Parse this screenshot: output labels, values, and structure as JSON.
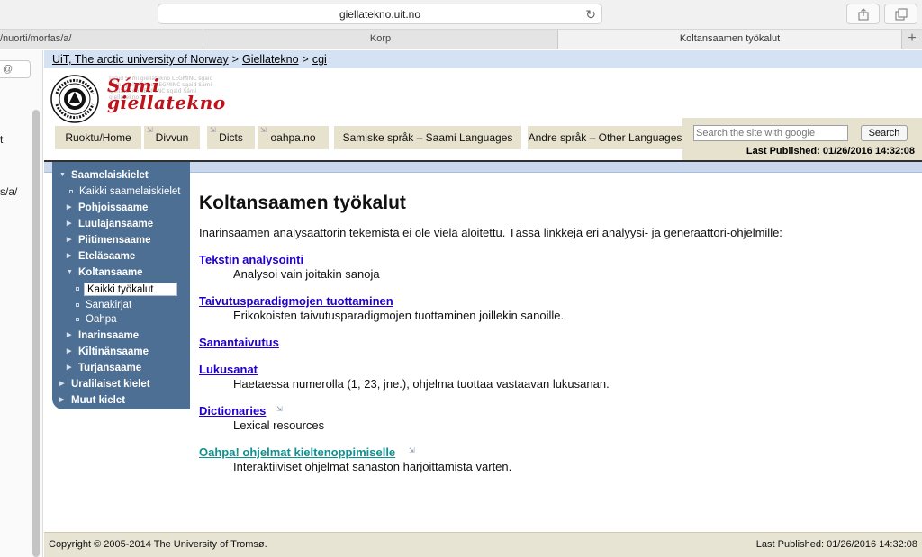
{
  "browser": {
    "address": "giellatekno.uit.no",
    "tabs": [
      "/nuorti/morfas/a/",
      "Korp",
      "Koltansaamen työkalut"
    ]
  },
  "sidepanel": {
    "lines": [
      "t",
      "s/a/"
    ]
  },
  "breadcrumb": {
    "items": [
      "UiT, The arctic university of Norway",
      "Giellatekno",
      "cgi"
    ],
    "separator": ">"
  },
  "logo": {
    "line1": "Sámi",
    "line2": "giellatekno",
    "seal_text": "ROMSSA UNIVERSITEHTA"
  },
  "nav": {
    "tabs": [
      "Ruoktu/Home",
      "Divvun",
      "Dicts",
      "oahpa.no",
      "Samiske språk – Saami Languages",
      "Andre språk – Other Languages"
    ]
  },
  "search": {
    "placeholder": "Search the site with google",
    "button": "Search"
  },
  "published": "Last Published: 01/26/2016 14:32:08",
  "menu": {
    "items": [
      {
        "label": "Saamelaiskielet",
        "level": 0,
        "open": true
      },
      {
        "label": "Kaikki saamelaiskielet",
        "level": 1
      },
      {
        "label": "Pohjoissaame",
        "level": 1,
        "group": true
      },
      {
        "label": "Luulajansaame",
        "level": 1,
        "group": true
      },
      {
        "label": "Piitimensaame",
        "level": 1,
        "group": true
      },
      {
        "label": "Eteläsaame",
        "level": 1,
        "group": true
      },
      {
        "label": "Koltansaame",
        "level": 1,
        "group": true,
        "open": true
      },
      {
        "label": "Kaikki työkalut",
        "level": 2,
        "selected": true
      },
      {
        "label": "Sanakirjat",
        "level": 2
      },
      {
        "label": "Oahpa",
        "level": 2
      },
      {
        "label": "Inarinsaame",
        "level": 1,
        "group": true
      },
      {
        "label": "Kiltinänsaame",
        "level": 1,
        "group": true
      },
      {
        "label": "Turjansaame",
        "level": 1,
        "group": true
      },
      {
        "label": "Uralilaiset kielet",
        "level": 0
      },
      {
        "label": "Muut kielet",
        "level": 0
      }
    ]
  },
  "content": {
    "title": "Koltansaamen työkalut",
    "intro": "Inarinsaamen analysaattorin tekemistä ei ole vielä aloitettu. Tässä linkkejä eri analyysi- ja generaattori-ohjelmille:",
    "entries": [
      {
        "link": "Tekstin analysointi",
        "desc": "Analysoi vain joitakin sanoja"
      },
      {
        "link": "Taivutusparadigmojen tuottaminen",
        "desc": "Erikokoisten taivutusparadigmojen tuottaminen joillekin sanoille."
      },
      {
        "link": "Sanantaivutus",
        "desc": ""
      },
      {
        "link": "Lukusanat",
        "desc": "Haetaessa numerolla (1, 23, jne.), ohjelma tuottaa vastaavan lukusanan."
      },
      {
        "link": "Dictionaries",
        "desc": "Lexical resources"
      },
      {
        "link": "Oahpa! ohjelmat kieltenoppimiselle",
        "desc": "Interaktiiviset ohjelmat sanaston harjoittamista varten."
      }
    ]
  },
  "footer": {
    "copyright": "Copyright © 2005-2014 The University of Tromsø.",
    "published": "Last Published: 01/26/2016 14:32:08"
  },
  "colors": {
    "menu_bg": "#4d6f94",
    "nav_bg": "#e7e2cd",
    "link": "#2200cc",
    "visited_link": "#119090",
    "logo_red": "#c0121a"
  }
}
